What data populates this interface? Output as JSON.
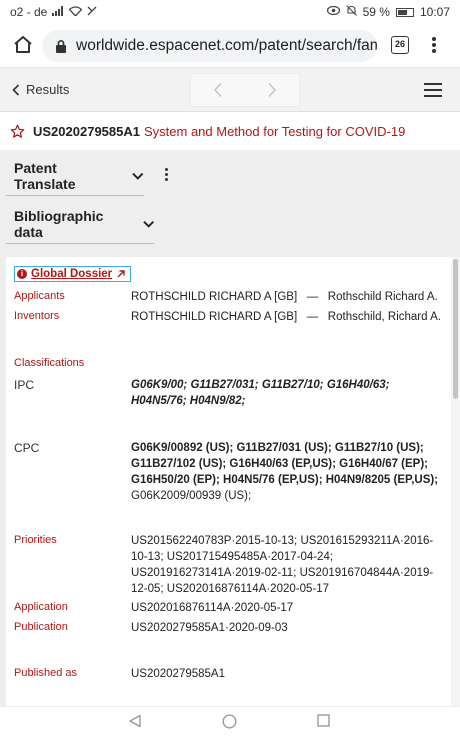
{
  "status_bar": {
    "carrier": "o2 - de",
    "battery": "59 %",
    "battery_level": 0.59,
    "time": "10:07",
    "icons": [
      "signal-icon",
      "wifi-icon",
      "nfc-icon",
      "eye-icon",
      "mute-icon",
      "battery-icon"
    ]
  },
  "browser": {
    "url": "worldwide.espacenet.com/patent/search/famil",
    "tab_count": "26",
    "icons": [
      "home-icon",
      "lock-icon",
      "menu-icon"
    ]
  },
  "toolbar": {
    "results_label": "Results"
  },
  "patent": {
    "number": "US2020279585A1",
    "title": "System and Method for Testing for COVID-19"
  },
  "sections": {
    "translate_label": "Patent Translate",
    "biblio_label": "Bibliographic data"
  },
  "biblio": {
    "global_dossier": "Global Dossier",
    "applicants_label": "Applicants",
    "applicants_value": "ROTHSCHILD RICHARD A [GB]   —   Rothschild Richard A.",
    "inventors_label": "Inventors",
    "inventors_value": "ROTHSCHILD RICHARD A [GB]   —   Rothschild, Richard A.",
    "classifications_label": "Classifications",
    "ipc_label": "IPC",
    "ipc_value": "G06K9/00; G11B27/031; G11B27/10; G16H40/63; H04N5/76; H04N9/82;",
    "cpc_label": "CPC",
    "cpc_value_bold": "G06K9/00892 (US); G11B27/031 (US); G11B27/10 (US); G11B27/102 (US); G16H40/63 (EP,US); G16H40/67 (EP); G16H50/20 (EP); H04N5/76 (EP,US); H04N9/8205 (EP,US);",
    "cpc_value_plain": "G06K2009/00939 (US);",
    "priorities_label": "Priorities",
    "priorities_value": "US201562240783P·2015-10-13; US201615293211A·2016-10-13; US201715495485A·2017-04-24; US201916273141A·2019-02-11; US201916704844A·2019-12-05; US202016876114A·2020-05-17",
    "application_label": "Application",
    "application_value": "US202016876114A·2020-05-17",
    "publication_label": "Publication",
    "publication_value": "US2020279585A1·2020-09-03",
    "published_as_label": "Published as",
    "published_as_value": "US2020279585A1"
  },
  "colors": {
    "accent_red": "#b01818",
    "focus_blue": "#3fa9e0",
    "panel_gray": "#eeeeee"
  }
}
